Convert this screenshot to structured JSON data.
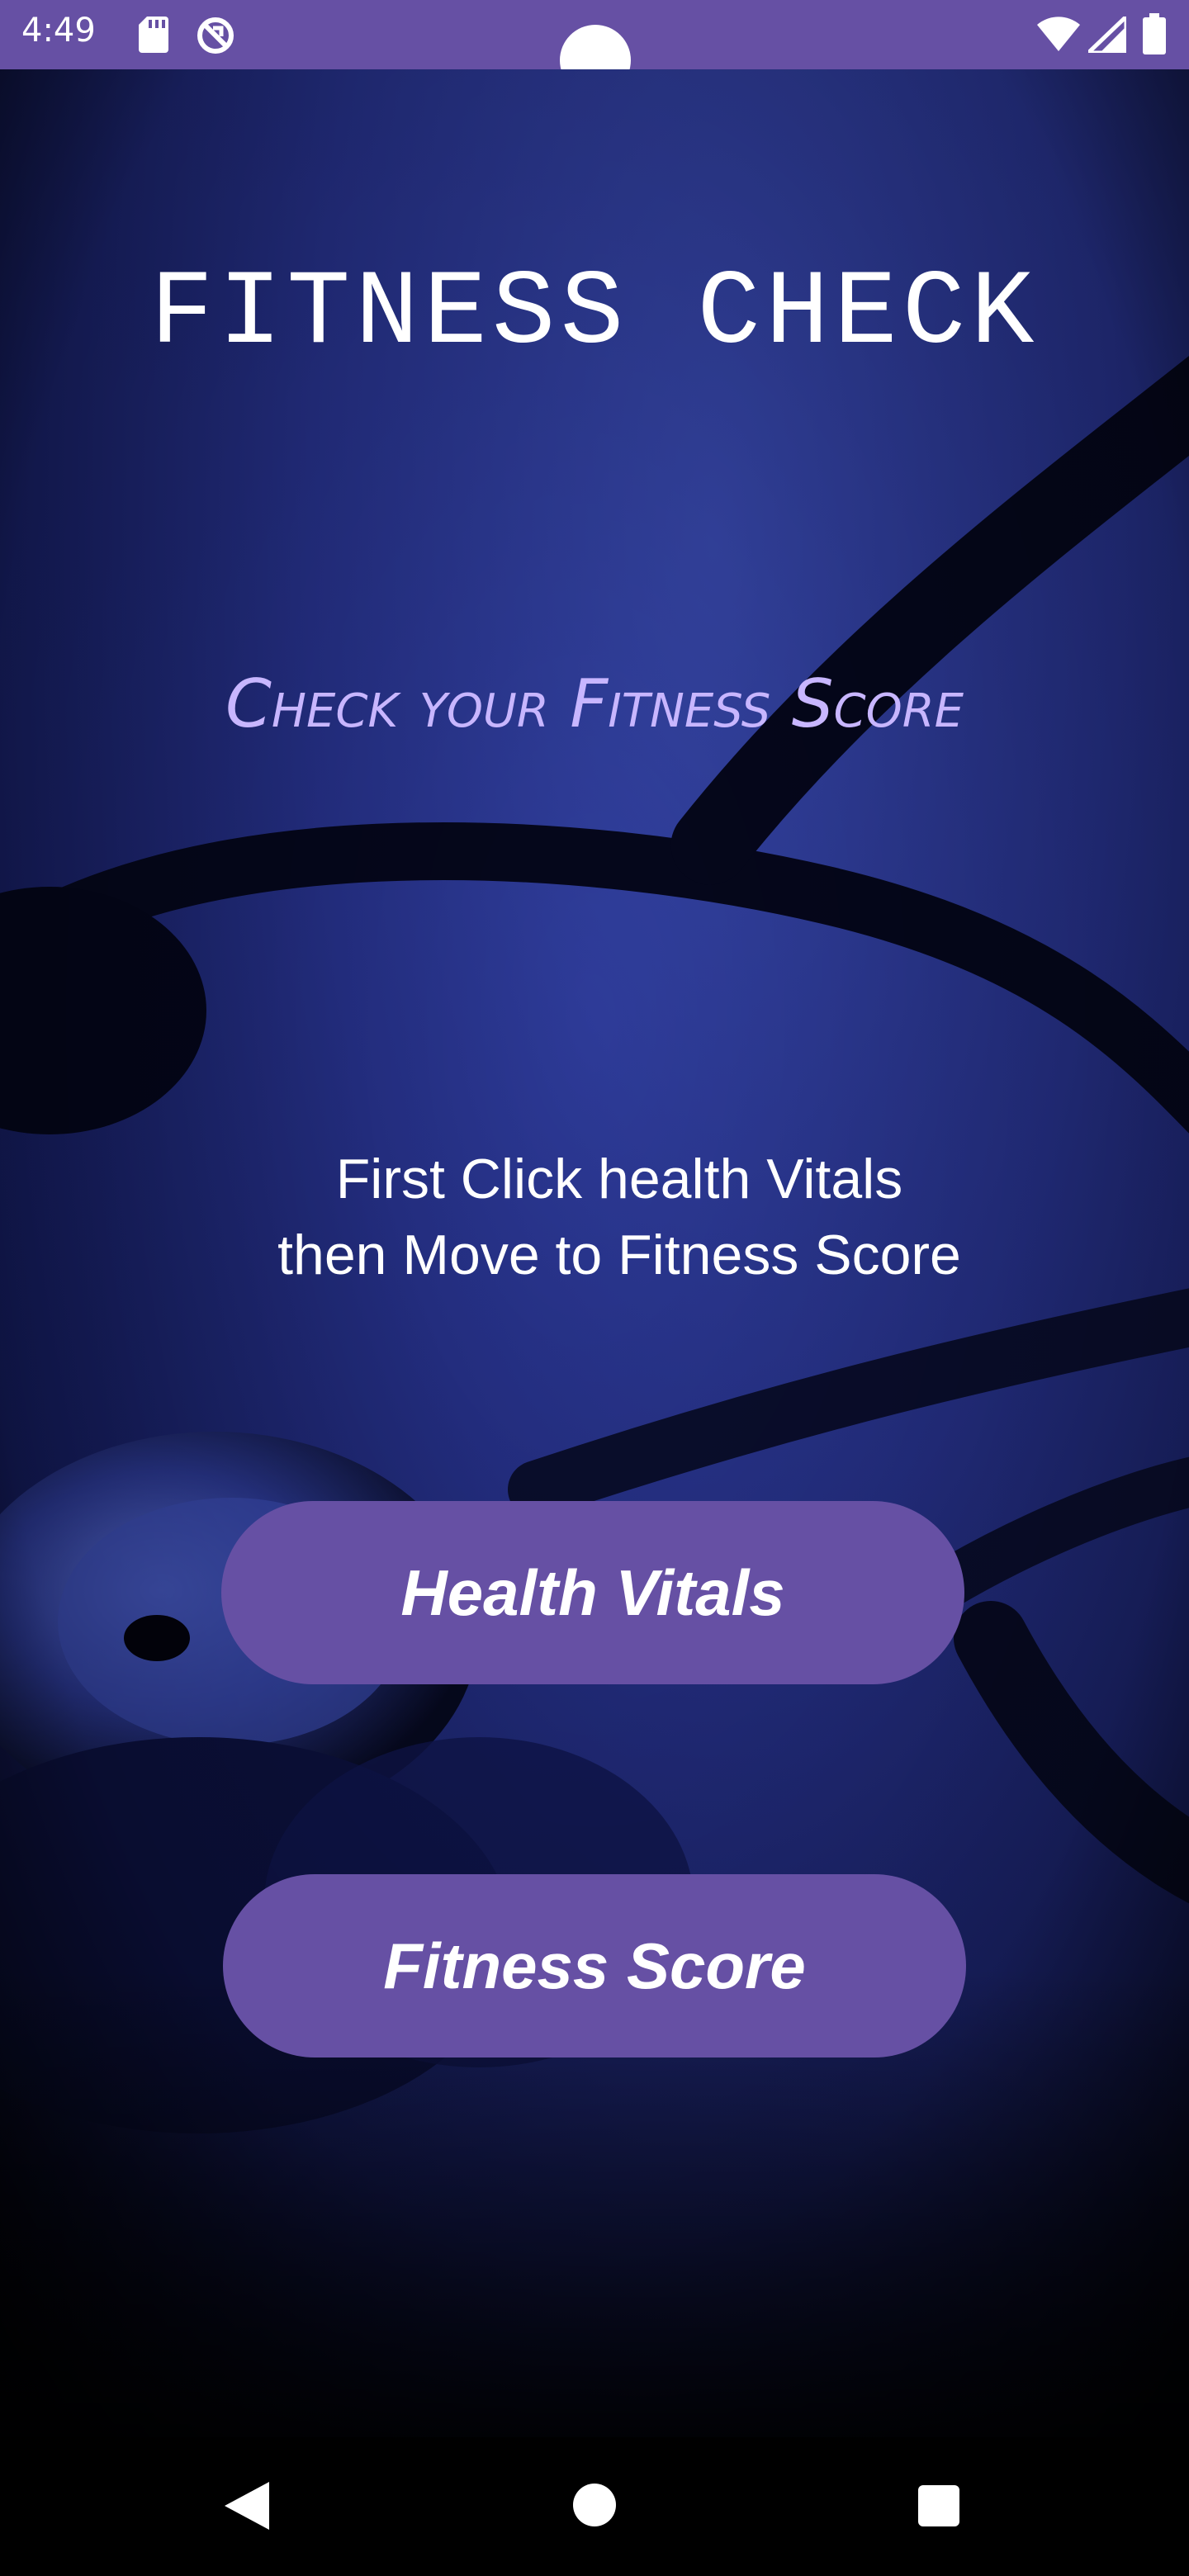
{
  "status_bar": {
    "time": "4:49",
    "icons": [
      "sd-card-icon",
      "sync-off-icon",
      "wifi-icon",
      "signal-icon",
      "battery-icon"
    ]
  },
  "main": {
    "title": "FITNESS CHECK",
    "subtitle": "Check your Fitness Score",
    "instruction_line1": "First Click health Vitals",
    "instruction_line2": "then Move to Fitness Score",
    "health_vitals_label": "Health Vitals",
    "fitness_score_label": "Fitness Score"
  },
  "colors": {
    "accent": "#6650a4",
    "subtitle": "#c8b6ff",
    "background": "#26318a"
  },
  "nav_bar": {
    "icons": [
      "back-icon",
      "home-icon",
      "recents-icon"
    ]
  }
}
